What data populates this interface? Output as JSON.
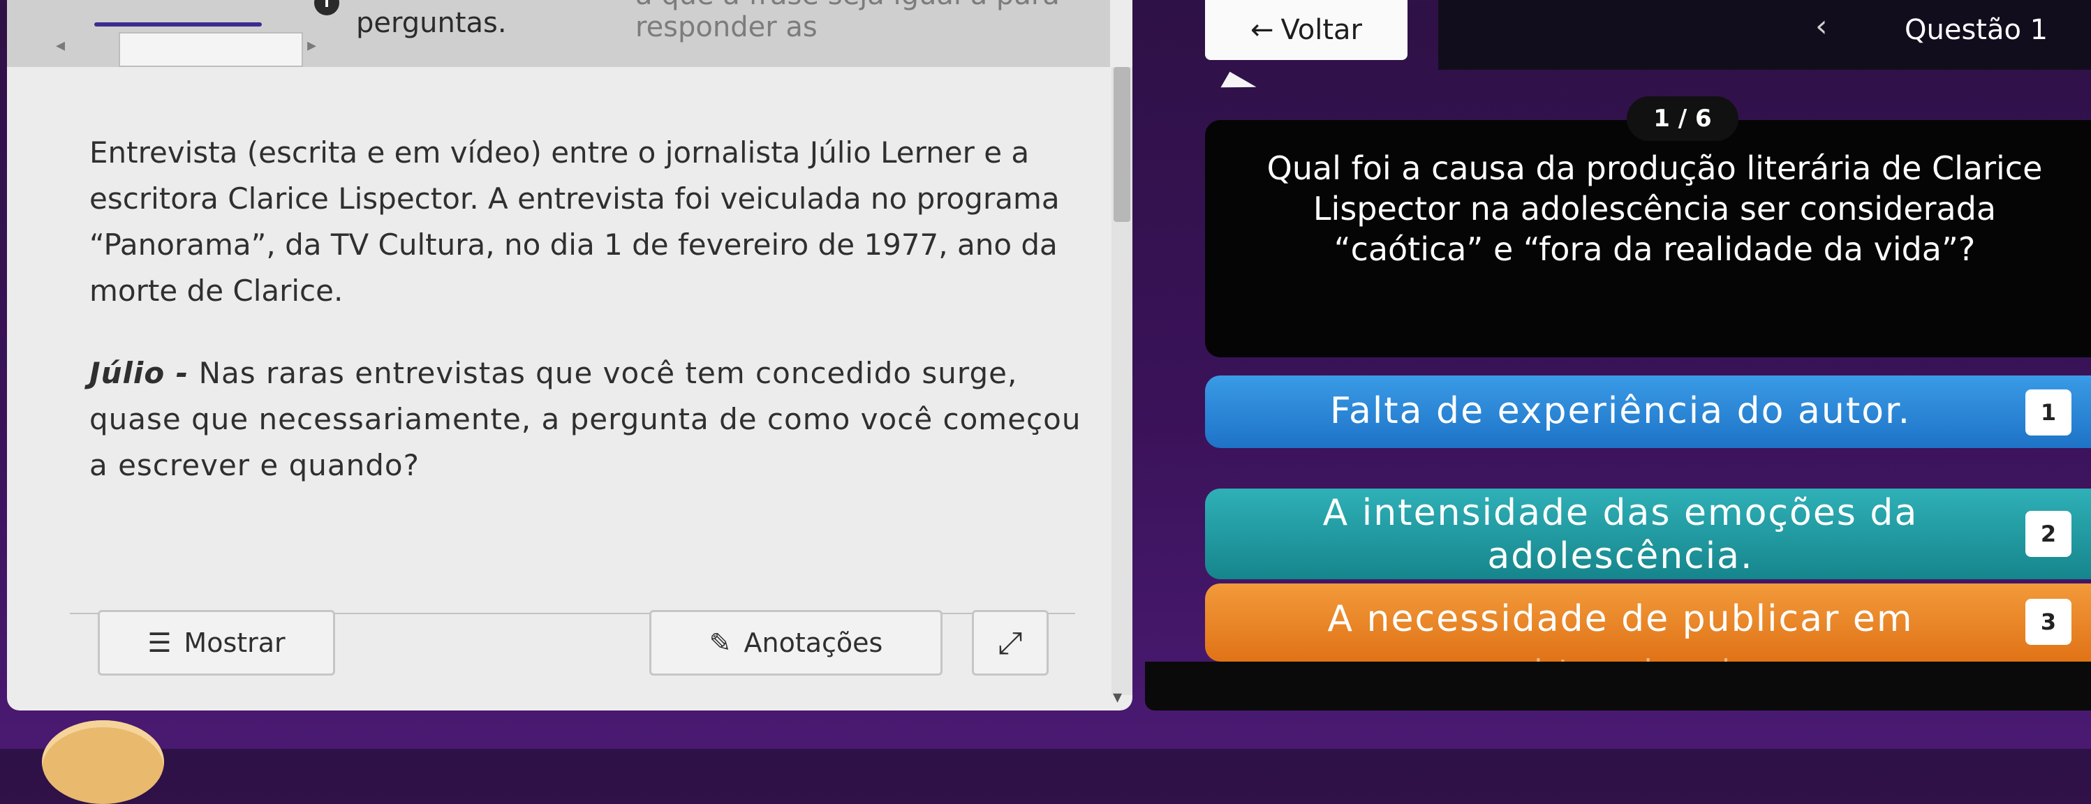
{
  "left": {
    "top_text": "perguntas.",
    "top_ghost_text": "a que a frase seja igual a para responder as",
    "info_icon": "i",
    "paragraphs": [
      "Entrevista (escrita e em vídeo) entre o jornalista Júlio Lerner e a escritora Clarice Lispector. A entrevista foi veiculada no programa “Panorama”, da TV Cultura, no dia 1 de fevereiro de 1977, ano da morte de Clarice."
    ],
    "speaker": "Júlio -",
    "speaker_text": "Nas raras entrevistas que você tem concedido surge, quase que necessariamente, a pergunta de como você começou a escrever e quando?",
    "buttons": {
      "show": "Mostrar",
      "notes": "Anotações"
    },
    "icons": {
      "show": "sliders-icon",
      "notes": "marker-icon",
      "expand": "expand-diagonal-icon"
    }
  },
  "right": {
    "back_label": "Voltar",
    "question_label": "Questão 1",
    "counter": "1 / 6",
    "question_text": "Qual foi a causa da produção literária de Clarice Lispector na adolescência ser considerada “caótica” e “fora da realidade da vida”?",
    "answers": [
      {
        "text": "Falta de experiência do autor.",
        "number": "1",
        "color": "#2a86d8"
      },
      {
        "text": "A intensidade das emoções da adolescência.",
        "number": "2",
        "color": "#1f9aa1"
      },
      {
        "text": "A necessidade de publicar em",
        "ghost": "revistas e jornais.",
        "number": "3",
        "color": "#ea8528"
      }
    ]
  }
}
